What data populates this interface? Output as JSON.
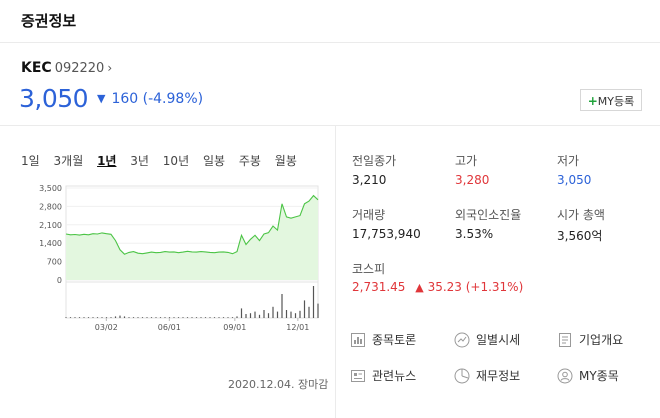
{
  "header": {
    "title": "증권정보"
  },
  "stock": {
    "name": "KEC",
    "code": "092220",
    "link_arrow": "›",
    "price": "3,050",
    "change_direction": "down",
    "change_icon": "▼",
    "change_text": "160 (-4.98%)",
    "my_button": {
      "plus": "+",
      "label": "MY등록"
    }
  },
  "periods": [
    "1일",
    "3개월",
    "1년",
    "3년",
    "10년",
    "일봉",
    "주봉",
    "월봉"
  ],
  "active_period": "1년",
  "chart_data": {
    "type": "area",
    "y_ticks": [
      "3,500",
      "2,800",
      "2,100",
      "1,400",
      "700",
      "0"
    ],
    "ylim": [
      0,
      3500
    ],
    "x_ticks": [
      "03/02",
      "06/01",
      "09/01",
      "12/01"
    ],
    "series": [
      {
        "values": [
          1750,
          1720,
          1730,
          1710,
          1740,
          1720,
          1760,
          1750,
          1790,
          1760,
          1740,
          1500,
          1150,
          980,
          1050,
          1080,
          1020,
          1000,
          1030,
          1060,
          1040,
          1050,
          1080,
          1060,
          1070,
          1040,
          1060,
          1090,
          1070,
          1060,
          1080,
          1070,
          1050,
          1040,
          1060,
          1070,
          1050,
          1000,
          1080,
          1700,
          1350,
          1550,
          1700,
          1500,
          1750,
          1800,
          2050,
          1900,
          2900,
          2400,
          2350,
          2400,
          2450,
          2900,
          3000,
          3210,
          3050
        ]
      }
    ],
    "volume": [
      1,
      1,
      1,
      1,
      1,
      1,
      1,
      1,
      1,
      1,
      1,
      2,
      3,
      2,
      1,
      1,
      1,
      1,
      1,
      1,
      1,
      1,
      1,
      1,
      1,
      1,
      1,
      1,
      1,
      1,
      1,
      1,
      1,
      1,
      1,
      1,
      1,
      1,
      2,
      12,
      5,
      6,
      8,
      4,
      10,
      6,
      14,
      8,
      30,
      10,
      8,
      6,
      9,
      22,
      14,
      40,
      18
    ]
  },
  "date_label": "2020.12.04. 장마감",
  "stats": [
    {
      "label": "전일종가",
      "value": "3,210",
      "color": ""
    },
    {
      "label": "고가",
      "value": "3,280",
      "color": "red"
    },
    {
      "label": "저가",
      "value": "3,050",
      "color": "blue"
    },
    {
      "label": "거래량",
      "value": "17,753,940",
      "color": ""
    },
    {
      "label": "외국인소진율",
      "value": "3.53%",
      "color": ""
    },
    {
      "label": "시가 총액",
      "value": "3,560억",
      "color": ""
    }
  ],
  "index": {
    "label": "코스피",
    "value": "2,731.45",
    "change_icon": "▲",
    "change_text": "35.23 (+1.31%)"
  },
  "links": [
    {
      "label": "종목토론",
      "icon": "chart-board-icon"
    },
    {
      "label": "일별시세",
      "icon": "trend-circle-icon"
    },
    {
      "label": "기업개요",
      "icon": "document-icon"
    },
    {
      "label": "관련뉴스",
      "icon": "news-icon"
    },
    {
      "label": "재무정보",
      "icon": "pie-chart-icon"
    },
    {
      "label": "MY종목",
      "icon": "user-circle-icon"
    }
  ]
}
